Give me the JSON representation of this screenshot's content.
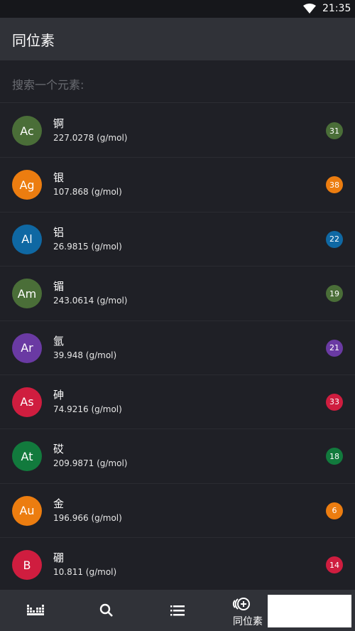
{
  "status": {
    "time": "21:35"
  },
  "app_bar": {
    "title": "同位素"
  },
  "search": {
    "placeholder": "搜索一个元素:"
  },
  "elements": [
    {
      "symbol": "Ac",
      "name": "锕",
      "mass": "227.0278 (g/mol)",
      "isotopes": "31",
      "color": "#4a6e38"
    },
    {
      "symbol": "Ag",
      "name": "银",
      "mass": "107.868 (g/mol)",
      "isotopes": "38",
      "color": "#ec7d10"
    },
    {
      "symbol": "Al",
      "name": "铝",
      "mass": "26.9815 (g/mol)",
      "isotopes": "22",
      "color": "#0f68a3"
    },
    {
      "symbol": "Am",
      "name": "镅",
      "mass": "243.0614 (g/mol)",
      "isotopes": "19",
      "color": "#4a6e38"
    },
    {
      "symbol": "Ar",
      "name": "氩",
      "mass": "39.948 (g/mol)",
      "isotopes": "21",
      "color": "#6a3aa3"
    },
    {
      "symbol": "As",
      "name": "砷",
      "mass": "74.9216 (g/mol)",
      "isotopes": "33",
      "color": "#cf1d3f"
    },
    {
      "symbol": "At",
      "name": "砹",
      "mass": "209.9871 (g/mol)",
      "isotopes": "18",
      "color": "#127a3d"
    },
    {
      "symbol": "Au",
      "name": "金",
      "mass": "196.966 (g/mol)",
      "isotopes": "6",
      "color": "#ec7d10"
    },
    {
      "symbol": "B",
      "name": "硼",
      "mass": "10.811 (g/mol)",
      "isotopes": "14",
      "color": "#cf1d3f"
    }
  ],
  "nav": {
    "items": [
      "periodic-table-icon",
      "search-icon",
      "list-icon",
      "isotope-icon"
    ],
    "active_label": "同位素"
  }
}
